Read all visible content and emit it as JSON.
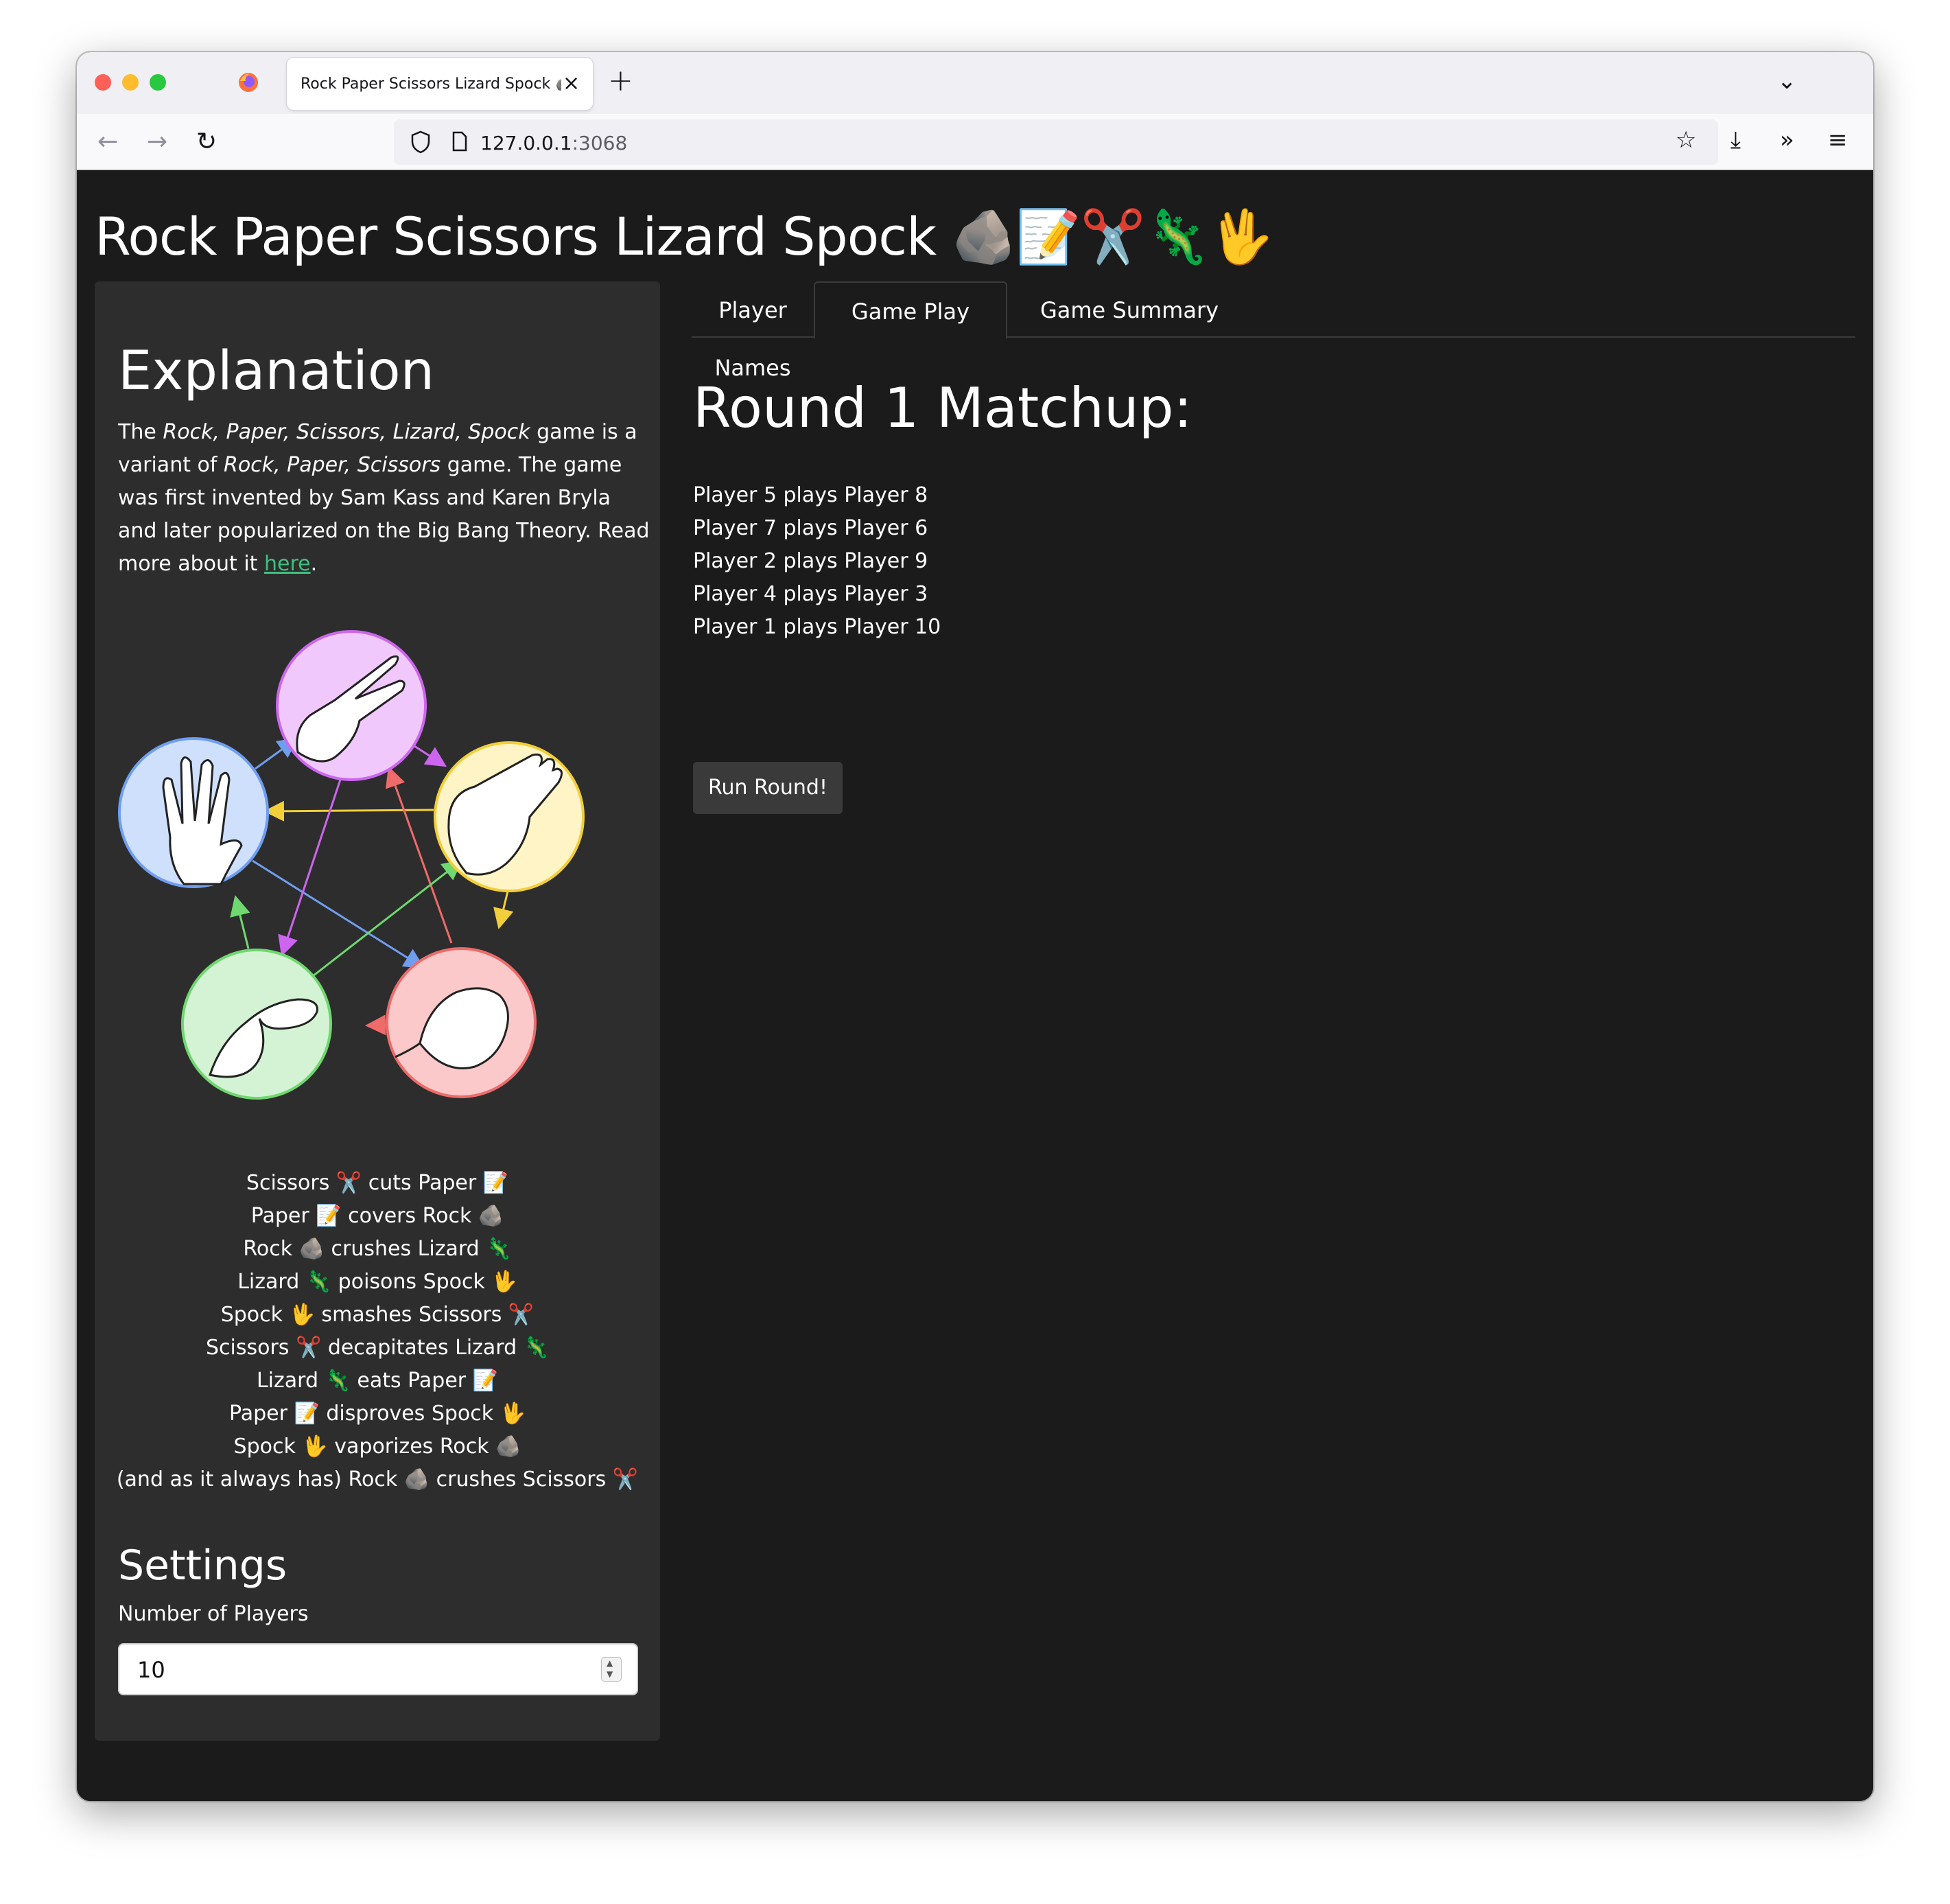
{
  "browser": {
    "tab_title": "Rock Paper Scissors Lizard Spock 🪨📝✂️🦎🖖",
    "tab_close": "×",
    "new_tab": "+",
    "url_host": "127.0.0.1",
    "url_port": ":3068"
  },
  "app": {
    "title": "Rock Paper Scissors Lizard Spock 🪨📝✂️🦎🖖"
  },
  "sidebar": {
    "explanation_title": "Explanation",
    "explanation": {
      "p1": "The ",
      "em1": "Rock, Paper, Scissors, Lizard, Spock",
      "p2": " game is a variant of ",
      "em2": "Rock, Paper, Scissors",
      "p3": " game. The game was first invented by Sam Kass and Karen Bryla and later popularized on the Big Bang Theory. Read more about it ",
      "link": "here",
      "p4": "."
    },
    "rules": [
      "Scissors ✂️ cuts Paper 📝",
      "Paper 📝 covers Rock 🪨",
      "Rock 🪨 crushes Lizard 🦎",
      "Lizard 🦎 poisons Spock 🖖",
      "Spock 🖖 smashes Scissors ✂️",
      "Scissors ✂️ decapitates Lizard 🦎",
      "Lizard 🦎 eats Paper 📝",
      "Paper 📝 disproves Spock 🖖",
      "Spock 🖖 vaporizes Rock 🪨",
      "(and as it always has) Rock 🪨 crushes Scissors ✂️"
    ],
    "settings_title": "Settings",
    "players_label": "Number of Players",
    "players_value": "10"
  },
  "tabs": [
    {
      "label": "Player Names",
      "active": false
    },
    {
      "label": "Game Play",
      "active": true
    },
    {
      "label": "Game Summary",
      "active": false
    }
  ],
  "main": {
    "round_title": "Round 1 Matchup:",
    "matchups": [
      "Player 5 plays Player 8",
      "Player 7 plays Player 6",
      "Player 2 plays Player 9",
      "Player 4 plays Player 3",
      "Player 1 plays Player 10"
    ],
    "run_button": "Run Round!"
  },
  "diagram_colors": {
    "scissors": "#f0c8fc",
    "paper": "#fff4c6",
    "rock": "#fbc9c9",
    "lizard": "#d4f3d4",
    "spock": "#cfe0fc",
    "scissors_stroke": "#cc66ee",
    "paper_stroke": "#f2cf3a",
    "rock_stroke": "#ee6b6b",
    "lizard_stroke": "#6fd86f",
    "spock_stroke": "#6f9ef0"
  }
}
